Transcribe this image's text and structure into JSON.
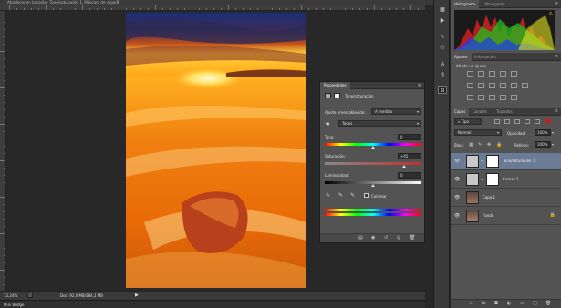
{
  "document": {
    "tab_title": "Atardecer en la costa · Tono/saturación 1, Máscara de capa/8"
  },
  "status": {
    "zoom": "12,24%",
    "doc_info": "Doc: 92,0 MB/184,1 MB"
  },
  "minibridge": {
    "label": "Mini Bridge"
  },
  "properties": {
    "tab": "Propiedades",
    "title": "Tono/saturación",
    "preset_label": "Ajuste preestablecido:",
    "preset_value": "A medida",
    "channel_value": "Todos",
    "hue_label": "Tono:",
    "hue_value": "0",
    "saturation_label": "Saturación:",
    "saturation_value": "+65",
    "lightness_label": "Luminosidad:",
    "lightness_value": "0",
    "colorize_label": "Colorear",
    "hue_level": 0.5,
    "saturation_level": 0.825,
    "lightness_level": 0.5
  },
  "histogram": {
    "tab": "Histograma",
    "tab2": "Navegador"
  },
  "adjustments": {
    "tab": "Ajustes",
    "tab2": "Información",
    "heading": "Añadir un ajuste"
  },
  "layers": {
    "tabs": [
      "Capas",
      "Canales",
      "Trazados"
    ],
    "filter_label": "Tipo",
    "blend_mode": "Normal",
    "opacity_label": "Opacidad:",
    "opacity_value": "100%",
    "lock_label": "Bloq.:",
    "fill_label": "Relleno:",
    "fill_value": "100%",
    "items": [
      {
        "name": "Tono/saturación 1"
      },
      {
        "name": "Curvas 1"
      },
      {
        "name": "Capa 1"
      },
      {
        "name": "Fondo"
      }
    ]
  },
  "colors": {
    "accent": "#6b7b95",
    "panel": "#535353",
    "bg": "#282828"
  }
}
